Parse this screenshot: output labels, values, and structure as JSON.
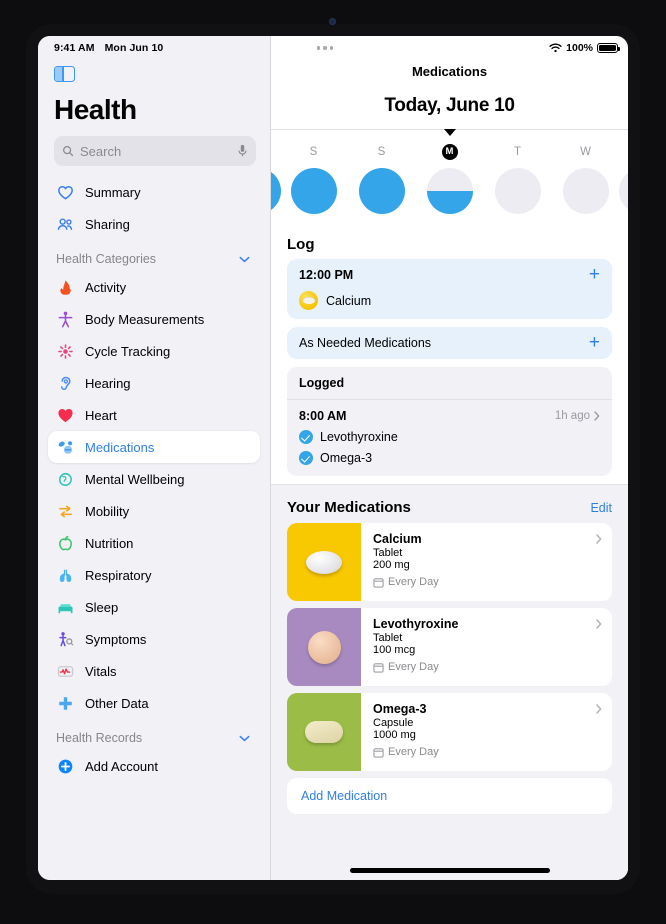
{
  "status_bar": {
    "time": "9:41 AM",
    "date": "Mon Jun 10",
    "battery_percent": "100%",
    "wifi_icon": "wifi-icon",
    "battery_icon": "battery-icon"
  },
  "sidebar": {
    "toggle_icon": "sidebar-toggle-icon",
    "app_title": "Health",
    "search": {
      "placeholder": "Search",
      "value": "",
      "search_icon": "search-icon",
      "mic_icon": "microphone-icon"
    },
    "top_items": [
      {
        "label": "Summary",
        "icon": "heart-outline-icon",
        "color": "#3b7ff0"
      },
      {
        "label": "Sharing",
        "icon": "people-icon",
        "color": "#3b7ff0"
      }
    ],
    "categories_section": {
      "label": "Health Categories",
      "chevron_icon": "chevron-down-icon"
    },
    "category_items": [
      {
        "label": "Activity",
        "icon": "flame-icon",
        "color": "#f4511e"
      },
      {
        "label": "Body Measurements",
        "icon": "body-icon",
        "color": "#9b4dd6"
      },
      {
        "label": "Cycle Tracking",
        "icon": "cycle-icon",
        "color": "#e8447a"
      },
      {
        "label": "Hearing",
        "icon": "ear-icon",
        "color": "#4b8ef7"
      },
      {
        "label": "Heart",
        "icon": "heart-filled-icon",
        "color": "#f52d4e"
      },
      {
        "label": "Medications",
        "icon": "pills-icon",
        "color": "#3b98f5",
        "selected": true
      },
      {
        "label": "Mental Wellbeing",
        "icon": "brain-head-icon",
        "color": "#2ec4b6"
      },
      {
        "label": "Mobility",
        "icon": "mobility-arrows-icon",
        "color": "#f5a623"
      },
      {
        "label": "Nutrition",
        "icon": "apple-icon",
        "color": "#3ec46d"
      },
      {
        "label": "Respiratory",
        "icon": "lungs-icon",
        "color": "#49b5f0"
      },
      {
        "label": "Sleep",
        "icon": "bed-icon",
        "color": "#2ec4b6"
      },
      {
        "label": "Symptoms",
        "icon": "symptoms-person-icon",
        "color": "#6b4ce0"
      },
      {
        "label": "Vitals",
        "icon": "waveform-icon",
        "color": "#f52d4e"
      },
      {
        "label": "Other Data",
        "icon": "plus-cross-icon",
        "color": "#49a8f0"
      }
    ],
    "records_section": {
      "label": "Health Records",
      "chevron_icon": "chevron-down-icon"
    },
    "add_account": {
      "label": "Add Account",
      "icon": "plus-circle-icon",
      "color": "#0a84ff"
    }
  },
  "main": {
    "more_icon": "more-dots-icon",
    "title": "Medications",
    "date_heading": "Today, June 10",
    "caret_icon": "caret-down-icon",
    "days": [
      {
        "label": "",
        "fill_percent": 100,
        "edge": true,
        "today": false
      },
      {
        "label": "S",
        "fill_percent": 100,
        "edge": false,
        "today": false
      },
      {
        "label": "S",
        "fill_percent": 100,
        "edge": false,
        "today": false
      },
      {
        "label": "M",
        "fill_percent": 50,
        "edge": false,
        "today": true
      },
      {
        "label": "T",
        "fill_percent": 0,
        "edge": false,
        "today": false
      },
      {
        "label": "W",
        "fill_percent": 0,
        "edge": false,
        "today": false
      },
      {
        "label": "",
        "fill_percent": 0,
        "edge": true,
        "today": false
      }
    ],
    "log_section": {
      "heading": "Log",
      "upcoming": {
        "time": "12:00 PM",
        "add_icon": "plus-icon",
        "medication": "Calcium",
        "pill_icon": "pill-yellow-icon"
      },
      "as_needed": {
        "label": "As Needed Medications",
        "add_icon": "plus-icon"
      }
    },
    "logged_section": {
      "heading": "Logged",
      "time": "8:00 AM",
      "relative_time": "1h ago",
      "chevron_icon": "chevron-right-icon",
      "items": [
        {
          "label": "Levothyroxine",
          "icon": "check-circle-icon"
        },
        {
          "label": "Omega-3",
          "icon": "check-circle-icon"
        }
      ]
    },
    "your_medications": {
      "heading": "Your Medications",
      "edit_label": "Edit",
      "cards": [
        {
          "name": "Calcium",
          "form": "Tablet",
          "dose": "200 mg",
          "frequency": "Every Day",
          "calendar_icon": "calendar-icon",
          "chevron_icon": "chevron-right-icon",
          "thumb_color": "#f8c800",
          "pill_shape": "oval",
          "pill_icon": "tablet-white-oval-icon"
        },
        {
          "name": "Levothyroxine",
          "form": "Tablet",
          "dose": "100 mcg",
          "frequency": "Every Day",
          "calendar_icon": "calendar-icon",
          "chevron_icon": "chevron-right-icon",
          "thumb_color": "#a98ac0",
          "pill_shape": "circle",
          "pill_icon": "tablet-peach-round-icon"
        },
        {
          "name": "Omega-3",
          "form": "Capsule",
          "dose": "1000 mg",
          "frequency": "Every Day",
          "calendar_icon": "calendar-icon",
          "chevron_icon": "chevron-right-icon",
          "thumb_color": "#9bbd47",
          "pill_shape": "capsule",
          "pill_icon": "capsule-cream-icon"
        }
      ],
      "add_medication_label": "Add Medication"
    }
  },
  "colors": {
    "accent_blue": "#2f7fe8",
    "ring_blue": "#34a5e8",
    "sidebar_bg": "#f2f1f6",
    "card_blue": "#e6f1fb"
  }
}
